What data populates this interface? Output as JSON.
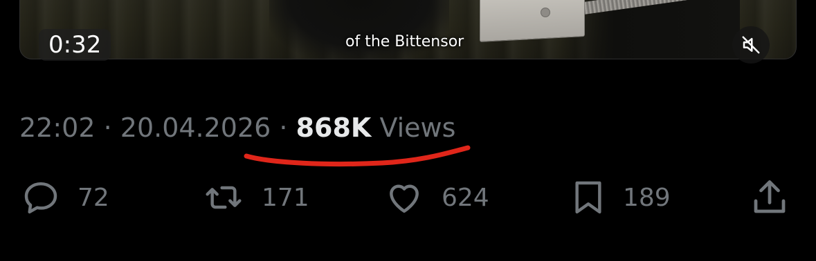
{
  "video": {
    "timestamp": "0:32",
    "caption": "of the Bittensor",
    "mute_icon": "speaker-muted-icon"
  },
  "meta": {
    "time": "22:02",
    "separator": " · ",
    "date": "20.04.2026",
    "views_count": "868K",
    "views_label": " Views"
  },
  "annotation": {
    "underline_color": "#e0261a"
  },
  "actions": {
    "reply": {
      "icon": "reply-icon",
      "count": "72"
    },
    "repost": {
      "icon": "repost-icon",
      "count": "171"
    },
    "like": {
      "icon": "heart-icon",
      "count": "624"
    },
    "bookmark": {
      "icon": "bookmark-icon",
      "count": "189"
    },
    "share": {
      "icon": "share-icon"
    }
  },
  "colors": {
    "background": "#000000",
    "muted_text": "#71767b",
    "bright_text": "#e7e9ea"
  }
}
